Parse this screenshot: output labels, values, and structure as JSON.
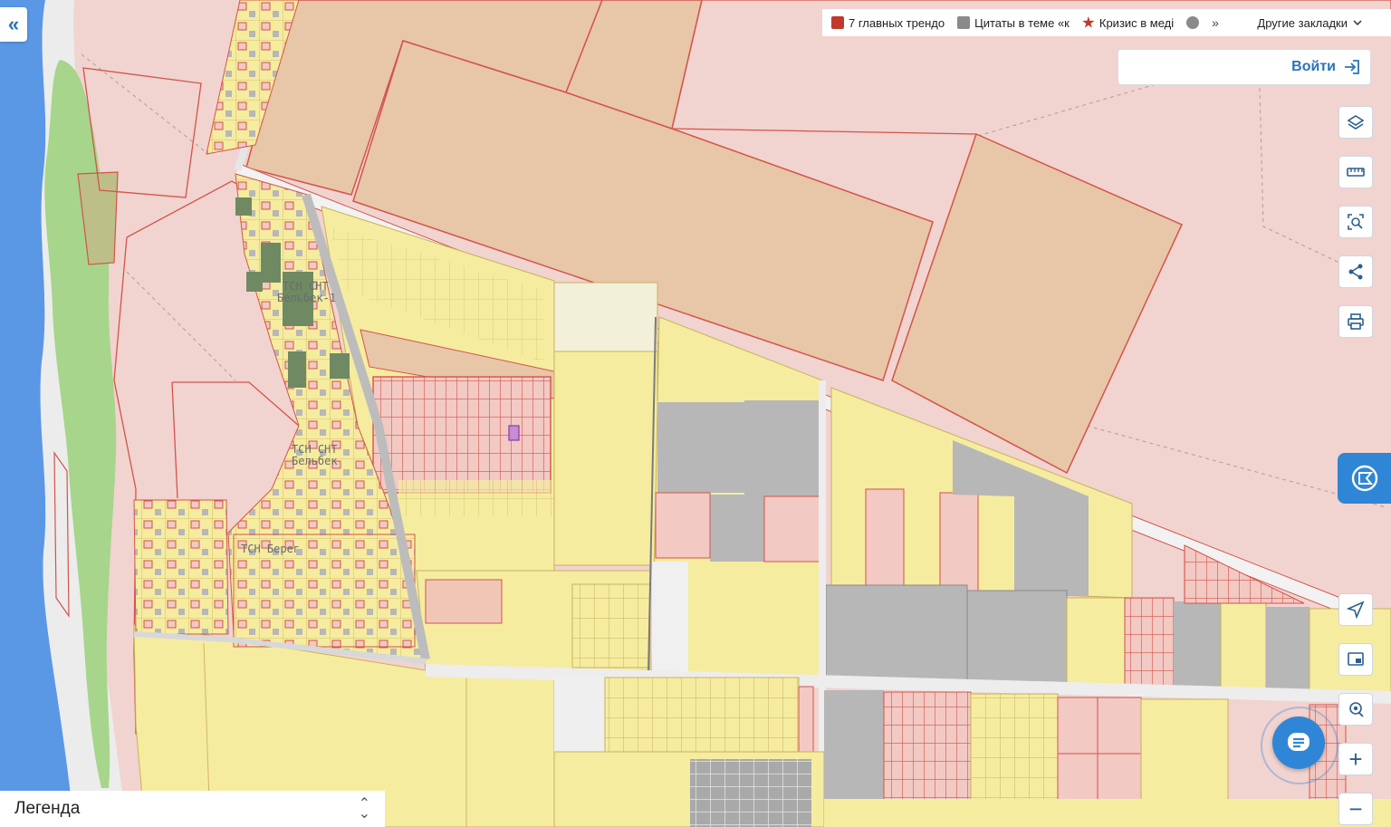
{
  "browser": {
    "bookmarks": [
      {
        "label": "7 главных трендо",
        "icon": "e-logo-icon",
        "color": "#c0392b"
      },
      {
        "label": "Цитаты в теме «к",
        "icon": "quote-site-icon",
        "color": "#8a8a8a"
      },
      {
        "label": "Кризис в меді",
        "icon": "star-site-icon",
        "color": "#c0392b"
      }
    ],
    "more_glyph": "»",
    "other_bookmarks_label": "Другие закладки"
  },
  "header": {
    "login_label": "Войти"
  },
  "sidebar": {
    "collapse_glyph": "«"
  },
  "toolbar": {
    "buttons": [
      "layers-icon",
      "ruler-icon",
      "area-search-icon",
      "share-icon",
      "print-icon",
      "locate-icon",
      "screen-icon",
      "geo-pin-icon",
      "zoom-in-icon",
      "zoom-out-icon"
    ],
    "zoom_in_label": "+",
    "zoom_out_label": "−"
  },
  "map": {
    "labels": {
      "snt_belbek_1_a": "ТСН СНТ",
      "snt_belbek_1_b": "Бельбек-1",
      "snt_belbek_a": "ТСН СНТ",
      "snt_belbek_b": "Бельбек",
      "tsn_bereg": "ТСН Берег"
    },
    "colors": {
      "sea": "#5a98e6",
      "forest": "#a6d58b",
      "agricultural": "#f0d2ce",
      "industrial": "#e8c6a8",
      "residential": "#f5eca0",
      "built": "#b7b7b7",
      "boundary": "#d3544a"
    }
  },
  "legend": {
    "title": "Легенда"
  }
}
